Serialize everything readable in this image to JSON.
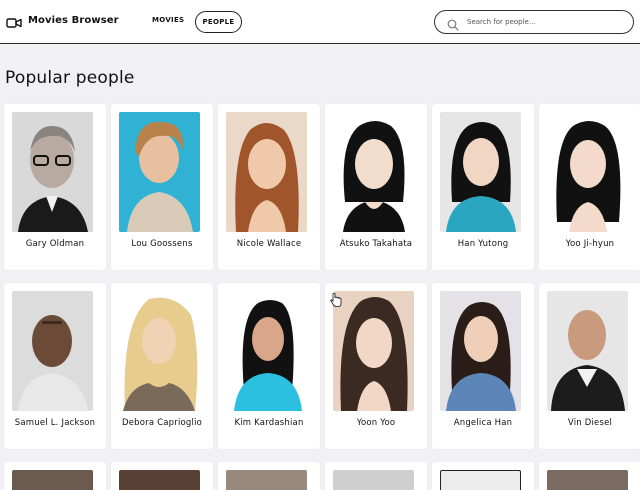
{
  "app": {
    "title": "Movies Browser"
  },
  "nav": {
    "movies_label": "MOVIES",
    "people_label": "PEOPLE"
  },
  "search": {
    "placeholder": "Search for people..."
  },
  "page": {
    "title": "Popular people"
  },
  "people_row1": [
    {
      "name": "Gary Oldman"
    },
    {
      "name": "Lou Goossens"
    },
    {
      "name": "Nicole Wallace"
    },
    {
      "name": "Atsuko Takahata"
    },
    {
      "name": "Han Yutong"
    },
    {
      "name": "Yoo Ji-hyun"
    }
  ],
  "people_row2": [
    {
      "name": "Samuel L. Jackson"
    },
    {
      "name": "Debora Caprioglio"
    },
    {
      "name": "Kim Kardashian"
    },
    {
      "name": "Yoon Yoo"
    },
    {
      "name": "Angelica Han"
    },
    {
      "name": "Vin Diesel"
    }
  ],
  "colors": {
    "accent": "#222222",
    "background": "#f1f1f5",
    "card": "#ffffff"
  }
}
